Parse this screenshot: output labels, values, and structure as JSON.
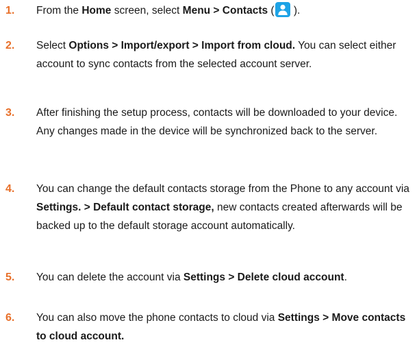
{
  "steps": [
    {
      "number": "1.",
      "parts": {
        "p1": "From the ",
        "p2": "Home",
        "p3": " screen, select ",
        "p4": "Menu > Contacts",
        "p5": " (",
        "p6": " )."
      },
      "icon": "contacts-icon",
      "icon_color": "#1ea3e6"
    },
    {
      "number": "2.",
      "parts": {
        "p1": "Select ",
        "p2": "Options > Import/export > Import from cloud.",
        "p3": " You can select either account to sync contacts from the selected account server."
      }
    },
    {
      "number": "3.",
      "parts": {
        "p1": "After finishing the setup process, contacts will be downloaded to your device. Any changes made in the device will be synchronized back to the server."
      }
    },
    {
      "number": "4.",
      "parts": {
        "p1": "You can change the default contacts storage from the Phone to any account via ",
        "p2": "Settings. > Default contact storage,",
        "p3": " new contacts created afterwards will be backed up to the default storage account automatically."
      }
    },
    {
      "number": "5.",
      "parts": {
        "p1": "You can delete the account via ",
        "p2": "Settings > Delete cloud account",
        "p3": "."
      }
    },
    {
      "number": "6.",
      "parts": {
        "p1": "You can also move the phone contacts to cloud via ",
        "p2": "Settings > Move contacts to cloud account."
      }
    }
  ],
  "colors": {
    "step_number": "#e8702a",
    "text": "#1a1a1a"
  }
}
